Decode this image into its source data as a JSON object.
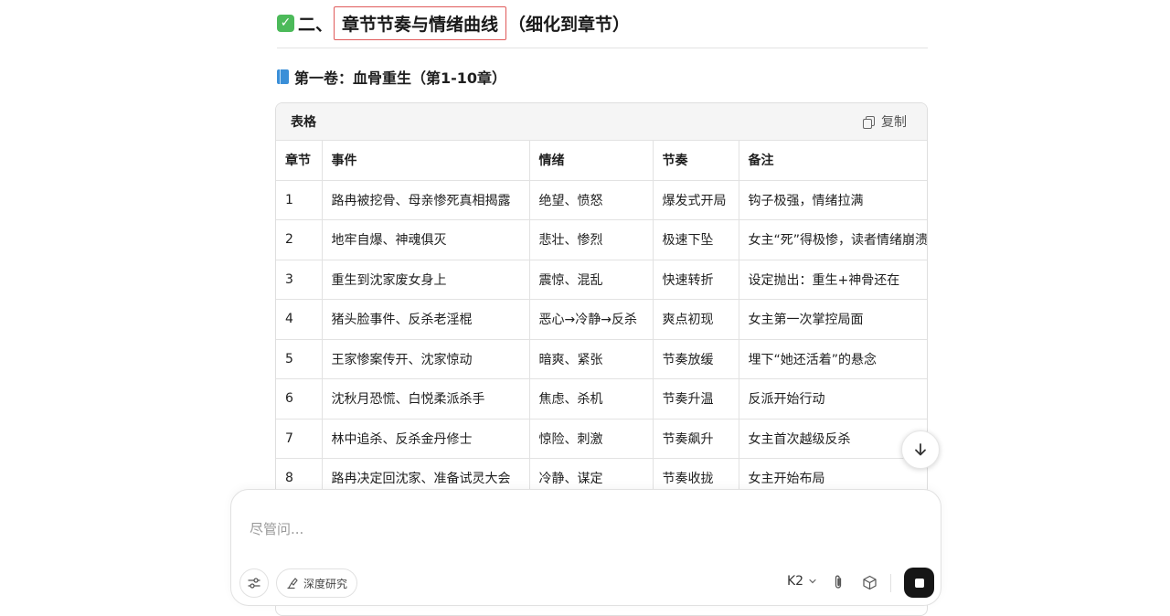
{
  "section": {
    "check_glyph": "✓",
    "prefix": "二、",
    "highlight": "章节节奏与情绪曲线",
    "suffix": "（细化到章节）"
  },
  "volume": {
    "title": "第一卷：血骨重生（第1-10章）"
  },
  "table": {
    "label": "表格",
    "copy_label": "复制",
    "headers": [
      "章节",
      "事件",
      "情绪",
      "节奏",
      "备注"
    ],
    "rows": [
      [
        "1",
        "路冉被挖骨、母亲惨死真相揭露",
        "绝望、愤怒",
        "爆发式开局",
        "钩子极强，情绪拉满"
      ],
      [
        "2",
        "地牢自爆、神魂俱灭",
        "悲壮、惨烈",
        "极速下坠",
        "女主“死”得极惨，读者情绪崩溃"
      ],
      [
        "3",
        "重生到沈家废女身上",
        "震惊、混乱",
        "快速转折",
        "设定抛出：重生+神骨还在"
      ],
      [
        "4",
        "猪头脸事件、反杀老淫棍",
        "恶心→冷静→反杀",
        "爽点初现",
        "女主第一次掌控局面"
      ],
      [
        "5",
        "王家惨案传开、沈家惊动",
        "暗爽、紧张",
        "节奏放缓",
        "埋下“她还活着”的悬念"
      ],
      [
        "6",
        "沈秋月恐慌、白悦柔派杀手",
        "焦虑、杀机",
        "节奏升温",
        "反派开始行动"
      ],
      [
        "7",
        "林中追杀、反杀金丹修士",
        "惊险、刺激",
        "节奏飙升",
        "女主首次越级反杀"
      ],
      [
        "8",
        "路冉决定回沈家、准备试灵大会",
        "冷静、谋定",
        "节奏收拢",
        "女主开始布局"
      ]
    ]
  },
  "composer": {
    "placeholder": "尽管问...",
    "research_label": "深度研究",
    "model_label": "K2"
  }
}
